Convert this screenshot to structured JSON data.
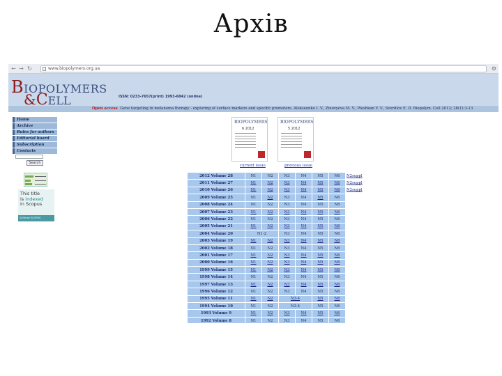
{
  "slide": {
    "title": "Архів"
  },
  "browser": {
    "back_icon": "back-arrow-icon",
    "forward_icon": "forward-arrow-icon",
    "reload_icon": "reload-icon",
    "url": "www.biopolymers.org.ua",
    "menu_icon": "wrench-icon"
  },
  "site": {
    "logo_line1_big": "B",
    "logo_line1_rest": "IOPOLYMERS",
    "logo_line2_amp": "&",
    "logo_line2_big": "C",
    "logo_line2_rest": "ELL",
    "issn": "ISSN: 0233-7657(print) 1993-6842 (online)",
    "ticker_oa": "Open access",
    "ticker_text": "Gene targeting in melanoma therapy - exploring of surface markers and specific promoters. Alekseenko I. V., Zinovyeva M. V., Pleshkan V. V., Sverdlov E. D. Biopolym. Cell 2012; 28(1):3-13"
  },
  "menu": {
    "items": [
      "Home",
      "Archive",
      "Rules for authors",
      "Editorial board",
      "Subscription",
      "Contacts"
    ],
    "search_label": "Search"
  },
  "stats_widget": {
    "icon": "counter-widget"
  },
  "scopus": {
    "line1": "This title",
    "line2_a": "is ",
    "line2_b": "indexed",
    "line3": "in Scopus",
    "foot": "SciVerse SCOPUS"
  },
  "covers": [
    {
      "title": "BIOPOLYMERS",
      "number": "6  2012"
    },
    {
      "title": "BIOPOLYMERS",
      "number": "5  2012"
    }
  ],
  "links": {
    "current": "current issue",
    "previous": "previous issue"
  },
  "volumes": [
    {
      "label": "2012 Volume 28",
      "cells": [
        "N1",
        "N2",
        "N3",
        "N4",
        "N5",
        "N6"
      ],
      "linked": [
        false,
        false,
        false,
        false,
        false,
        false
      ],
      "suppl": "N2suppl"
    },
    {
      "label": "2011 Volume 27",
      "cells": [
        "N1",
        "N2",
        "N3",
        "N4",
        "N5",
        "N6"
      ],
      "linked": [
        true,
        true,
        true,
        true,
        true,
        true
      ],
      "suppl": "N2suppl"
    },
    {
      "label": "2010 Volume 26",
      "cells": [
        "N1",
        "N2",
        "N3",
        "N4",
        "N5",
        "N6"
      ],
      "linked": [
        true,
        true,
        true,
        true,
        true,
        true
      ],
      "suppl": "N2suppl"
    },
    {
      "label": "2009 Volume 25",
      "cells": [
        "N1",
        "N2",
        "N3",
        "N4",
        "N5",
        "N6"
      ],
      "linked": [
        false,
        true,
        false,
        false,
        true,
        false
      ],
      "suppl": ""
    },
    {
      "label": "2008 Volume 24",
      "cells": [
        "N1",
        "N2",
        "N3",
        "N4",
        "N5",
        "N6"
      ],
      "linked": [
        false,
        false,
        false,
        false,
        false,
        false
      ],
      "suppl": ""
    },
    {
      "label": "2007 Volume 23",
      "cells": [
        "N1",
        "N2",
        "N3",
        "N4",
        "N5",
        "N6"
      ],
      "linked": [
        true,
        true,
        true,
        true,
        true,
        true
      ],
      "suppl": ""
    },
    {
      "label": "2006 Volume 22",
      "cells": [
        "N1",
        "N2",
        "N3",
        "N4",
        "N5",
        "N6"
      ],
      "linked": [
        false,
        false,
        false,
        false,
        false,
        false
      ],
      "suppl": ""
    },
    {
      "label": "2005 Volume 21",
      "cells": [
        "N1",
        "N2",
        "N3",
        "N4",
        "N5",
        "N6"
      ],
      "linked": [
        true,
        true,
        true,
        true,
        true,
        true
      ],
      "suppl": ""
    },
    {
      "label": "2004 Volume 20",
      "cells": [
        "N1-2",
        "N3",
        "N4",
        "N5",
        "N6"
      ],
      "linked": [
        false,
        false,
        false,
        false,
        false
      ],
      "suppl": ""
    },
    {
      "label": "2003 Volume 19",
      "cells": [
        "N1",
        "N2",
        "N3",
        "N4",
        "N5",
        "N6"
      ],
      "linked": [
        true,
        true,
        true,
        true,
        true,
        true
      ],
      "suppl": ""
    },
    {
      "label": "2002 Volume 18",
      "cells": [
        "N1",
        "N2",
        "N3",
        "N4",
        "N5",
        "N6"
      ],
      "linked": [
        false,
        false,
        false,
        false,
        false,
        false
      ],
      "suppl": ""
    },
    {
      "label": "2001 Volume 17",
      "cells": [
        "N1",
        "N2",
        "N3",
        "N4",
        "N5",
        "N6"
      ],
      "linked": [
        true,
        true,
        true,
        true,
        true,
        true
      ],
      "suppl": ""
    },
    {
      "label": "2000 Volume 16",
      "cells": [
        "N1",
        "N2",
        "N3",
        "N4",
        "N5",
        "N6"
      ],
      "linked": [
        true,
        true,
        true,
        true,
        true,
        true
      ],
      "suppl": ""
    },
    {
      "label": "1999 Volume 15",
      "cells": [
        "N1",
        "N2",
        "N3",
        "N4",
        "N5",
        "N6"
      ],
      "linked": [
        true,
        true,
        true,
        true,
        true,
        true
      ],
      "suppl": ""
    },
    {
      "label": "1998 Volume 14",
      "cells": [
        "N1",
        "N2",
        "N3",
        "N4",
        "N5",
        "N6"
      ],
      "linked": [
        false,
        false,
        false,
        false,
        false,
        false
      ],
      "suppl": ""
    },
    {
      "label": "1997 Volume 13",
      "cells": [
        "N1",
        "N2",
        "N3",
        "N4",
        "N5",
        "N6"
      ],
      "linked": [
        true,
        true,
        true,
        true,
        true,
        true
      ],
      "suppl": ""
    },
    {
      "label": "1996 Volume 12",
      "cells": [
        "N1",
        "N2",
        "N3",
        "N4",
        "N5",
        "N6"
      ],
      "linked": [
        false,
        false,
        false,
        false,
        false,
        false
      ],
      "suppl": ""
    },
    {
      "label": "1995 Volume 11",
      "cells": [
        "N1",
        "N2",
        "N3-4",
        "N5",
        "N6"
      ],
      "linked": [
        true,
        true,
        true,
        true,
        true
      ],
      "suppl": ""
    },
    {
      "label": "1994 Volume 10",
      "cells": [
        "N1",
        "N2",
        "N3-4",
        "N5",
        "N6"
      ],
      "linked": [
        false,
        false,
        false,
        false,
        false
      ],
      "suppl": ""
    },
    {
      "label": "1993 Volume 9",
      "cells": [
        "N1",
        "N2",
        "N3",
        "N4",
        "N5",
        "N6"
      ],
      "linked": [
        true,
        true,
        true,
        true,
        true,
        true
      ],
      "suppl": ""
    },
    {
      "label": "1992 Volume 8",
      "cells": [
        "N1",
        "N2",
        "N3",
        "N4",
        "N5",
        "N6"
      ],
      "linked": [
        false,
        false,
        false,
        false,
        false,
        false
      ],
      "suppl": ""
    }
  ]
}
